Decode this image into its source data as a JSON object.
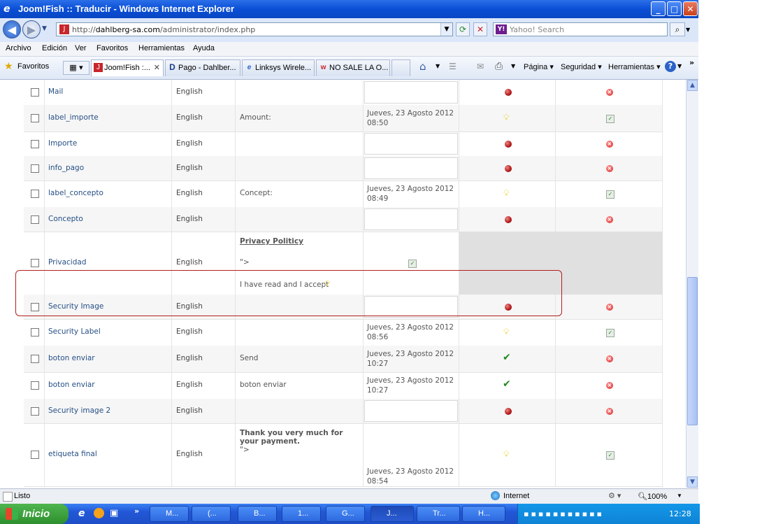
{
  "window": {
    "title": "Joom!Fish :: Traducir - Windows Internet Explorer",
    "controls": {
      "minimize": "_",
      "maximize": "□",
      "close": "✕"
    }
  },
  "address_bar": {
    "url_prefix": "http://",
    "url_host": "dahlberg-sa.com",
    "url_path": "/administrator/index.php",
    "search_placeholder": "Yahoo! Search"
  },
  "menu": [
    "Archivo",
    "Edición",
    "Ver",
    "Favoritos",
    "Herramientas",
    "Ayuda"
  ],
  "toolbar": {
    "favorites_label": "Favoritos",
    "tabs": [
      {
        "label": "Joom!Fish :...",
        "active": true
      },
      {
        "label": "Pago - Dahlber...",
        "active": false
      },
      {
        "label": "Linksys Wirele...",
        "active": false
      },
      {
        "label": "NO SALE LA O...",
        "active": false
      }
    ],
    "page_label": "Página",
    "security_label": "Seguridad",
    "tools_label": "Herramientas"
  },
  "rows": [
    {
      "name": "Mail",
      "lang": "English",
      "trans": "",
      "date": "",
      "state": "empty"
    },
    {
      "name": "label_importe",
      "lang": "English",
      "trans": "Amount:",
      "date": "Jueves, 23 Agosto 2012 08:50",
      "state": "bulb"
    },
    {
      "name": "Importe",
      "lang": "English",
      "trans": "",
      "date": "",
      "state": "empty"
    },
    {
      "name": "info_pago",
      "lang": "English",
      "trans": "",
      "date": "",
      "state": "empty"
    },
    {
      "name": "label_concepto",
      "lang": "English",
      "trans": "Concept:",
      "date": "Jueves, 23 Agosto 2012 08:49",
      "state": "bulb"
    },
    {
      "name": "Concepto",
      "lang": "English",
      "trans": "",
      "date": "",
      "state": "empty"
    },
    {
      "name": "Privacidad",
      "lang": "English",
      "trans_title": "Privacy Politicy",
      "trans_mid": "\">",
      "trans_tail": "I have read and I accept",
      "date": "",
      "state": "special"
    },
    {
      "name": "Security Image",
      "lang": "English",
      "trans": "",
      "date": "",
      "state": "empty"
    },
    {
      "name": "Security Label",
      "lang": "English",
      "trans": "",
      "date": "Jueves, 23 Agosto 2012 08:56",
      "state": "bulb"
    },
    {
      "name": "boton enviar",
      "lang": "English",
      "trans": "Send",
      "date": "Jueves, 23 Agosto 2012 10:27",
      "state": "tick"
    },
    {
      "name": "boton enviar",
      "lang": "English",
      "trans": "boton enviar",
      "date": "Jueves, 23 Agosto 2012 10:27",
      "state": "tick"
    },
    {
      "name": "Security image 2",
      "lang": "English",
      "trans": "",
      "date": "",
      "state": "empty"
    },
    {
      "name": "etiqueta final",
      "lang": "English",
      "trans_title": "Thank you very much for your payment.",
      "trans_mid": "\">",
      "date": "Jueves, 23 Agosto 2012 08:54",
      "state": "bulb"
    }
  ],
  "status": {
    "left": "Listo",
    "zone": "Internet",
    "zoom": "100%"
  },
  "taskbar": {
    "start": "Inicio",
    "buttons": [
      "M...",
      "(...",
      "B...",
      "1...",
      "G...",
      "J...",
      "Tr...",
      "H..."
    ],
    "clock": "12:28"
  }
}
